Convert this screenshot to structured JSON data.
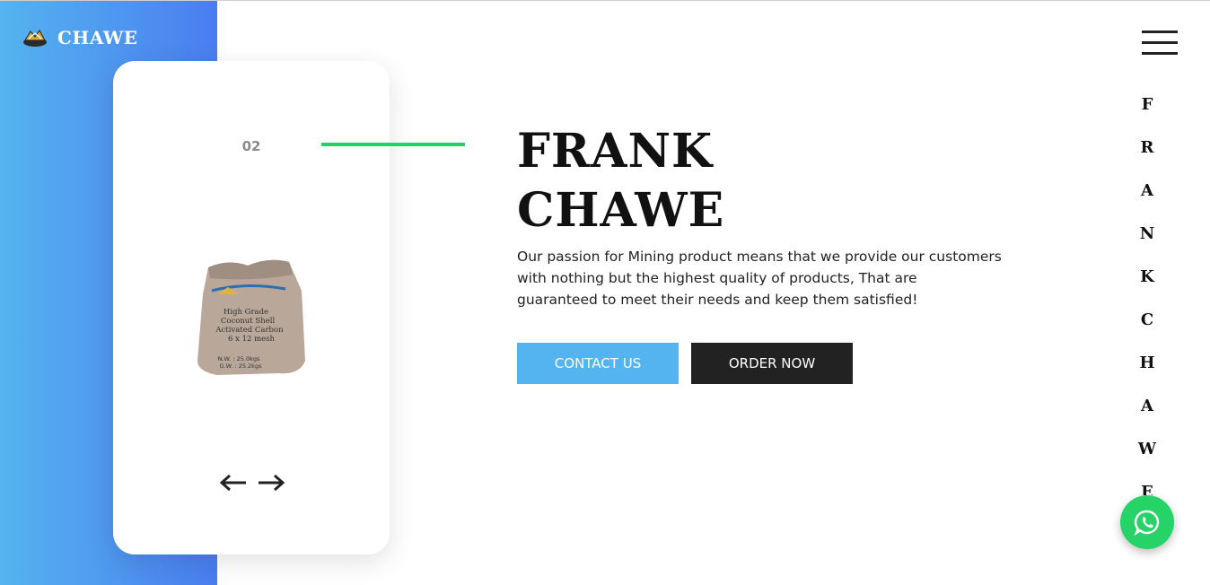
{
  "brand": {
    "name": "CHAWE",
    "icon": "logo-icon"
  },
  "slider": {
    "number": "02",
    "product_image": "product-bag-image",
    "prev_icon": "arrow-left-icon",
    "next_icon": "arrow-right-icon"
  },
  "hero": {
    "title_line1": "FRANK",
    "title_line2": "CHAWE",
    "description": "Our passion for Mining product means that we provide our customers with nothing but the highest quality of products, That are guaranteed to meet their needs and keep them satisfied!",
    "contact_label": "CONTACT US",
    "order_label": "ORDER NOW"
  },
  "side_letters": [
    "F",
    "R",
    "A",
    "N",
    "K",
    "C",
    "H",
    "A",
    "W",
    "E"
  ],
  "colors": {
    "sidebar_start": "#54b4ef",
    "sidebar_end": "#4a7df0",
    "accent_green": "#23d16b",
    "contact_button": "#54b4ef",
    "order_button": "#222222",
    "whatsapp": "#25d366"
  },
  "icons": {
    "menu": "hamburger-menu-icon",
    "whatsapp": "whatsapp-icon"
  }
}
